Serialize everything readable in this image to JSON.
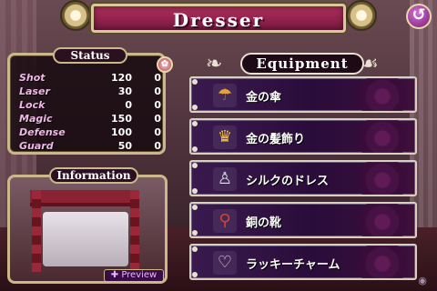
{
  "header": {
    "title": "Dresser",
    "back_icon": "back-arrow-icon"
  },
  "status": {
    "label": "Status",
    "icon": "status-toggle-icon",
    "stats": [
      {
        "name": "Shot",
        "value": "120",
        "bonus": "0"
      },
      {
        "name": "Laser",
        "value": "30",
        "bonus": "0"
      },
      {
        "name": "Lock",
        "value": "0",
        "bonus": "0"
      },
      {
        "name": "Magic",
        "value": "150",
        "bonus": "0"
      },
      {
        "name": "Defense",
        "value": "100",
        "bonus": "0"
      },
      {
        "name": "Guard",
        "value": "50",
        "bonus": "0"
      }
    ]
  },
  "information": {
    "label": "Information",
    "preview_label": "Preview"
  },
  "equipment": {
    "label": "Equipment",
    "items": [
      {
        "name": "金の傘",
        "icon": "umbrella-icon",
        "glyph": "☂"
      },
      {
        "name": "金の髪飾り",
        "icon": "crown-icon",
        "glyph": "♛"
      },
      {
        "name": "シルクのドレス",
        "icon": "dress-icon",
        "glyph": "♙"
      },
      {
        "name": "銅の靴",
        "icon": "shoes-icon",
        "glyph": "⚲"
      },
      {
        "name": "ラッキーチャーム",
        "icon": "heart-charm-icon",
        "glyph": "♡"
      }
    ]
  },
  "colors": {
    "banner": "#9a2452",
    "stat_name": "#f2b6e8",
    "panel_border": "#cbb88a",
    "equip_bg": "#2a0c3a"
  }
}
